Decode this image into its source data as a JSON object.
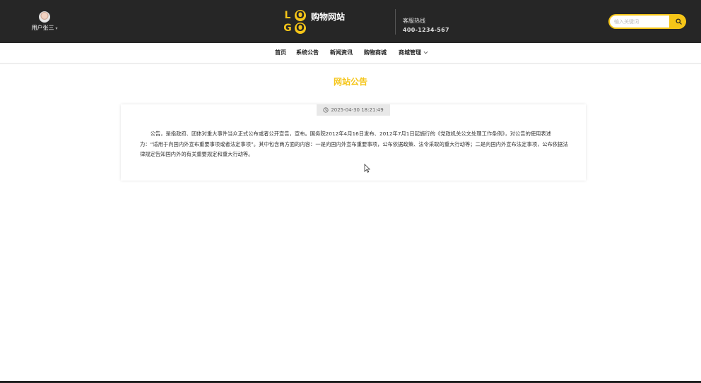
{
  "header": {
    "user_name": "用户张三",
    "user_caret": "▾",
    "logo_letters": [
      "L",
      "O",
      "G",
      "O"
    ],
    "site_name": "购物网站",
    "hotline_label": "客服热线",
    "hotline_number": "400-1234-567",
    "search_placeholder": "输入关键词",
    "accent_color": "#f5c518",
    "background_color": "#262626"
  },
  "nav": {
    "items": [
      {
        "label": "首页"
      },
      {
        "label": "系统公告"
      },
      {
        "label": "新闻资讯"
      },
      {
        "label": "购物商城"
      },
      {
        "label": "商城管理",
        "has_dropdown": true
      }
    ],
    "dropdown_icon": "chevron-down-icon"
  },
  "main": {
    "title": "网站公告",
    "timestamp": "2025-04-30 18:21:49",
    "timestamp_icon": "clock-icon",
    "content": "公告，是指政府、团体对重大事件当众正式公布或者公开宣告，宣布。国务院2012年4月16日发布、2012年7月1日起施行的《党政机关公文处理工作条例》，对公告的使用表述为：“适用于向国内外宣布重要事项或者法定事项”。其中包含两方面的内容：一是向国内外宣布重要事项，公布依据政策、法令采取的重大行动等；二是向国内外宣布法定事项，公布依据法律规定告知国内外的有关重要规定和重大行动等。"
  }
}
